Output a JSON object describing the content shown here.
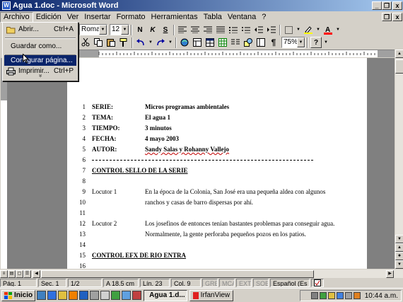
{
  "window": {
    "title": "Agua 1.doc - Microsoft Word",
    "minimize": "_",
    "restore": "❐",
    "close": "x"
  },
  "menubar": [
    "Archivo",
    "Edición",
    "Ver",
    "Insertar",
    "Formato",
    "Herramientas",
    "Tabla",
    "Ventana",
    "?"
  ],
  "doc_controls": {
    "restore": "❐",
    "close": "x"
  },
  "toolbar": {
    "font": "Roman",
    "size": "12",
    "zoom": "75%",
    "bold": "N",
    "italic": "K",
    "underline": "S",
    "help": "?"
  },
  "file_menu": {
    "items": [
      {
        "label": "Abrir...",
        "shortcut": "Ctrl+A",
        "icon": "folder-open-icon"
      },
      {
        "label": "Guardar como...",
        "shortcut": ""
      },
      {
        "label": "Configurar página...",
        "shortcut": "",
        "highlighted": true
      },
      {
        "label": "Imprimir...",
        "shortcut": "Ctrl+P",
        "icon": "printer-icon"
      }
    ],
    "expand": "»"
  },
  "document": {
    "lines": [
      {
        "n": "1",
        "c1": "SERIE:",
        "c2": "Micros programas ambientales",
        "bold": true
      },
      {
        "n": "2",
        "c1": "TEMA:",
        "c2": "El agua 1",
        "bold": true
      },
      {
        "n": "3",
        "c1": "TIEMPO:",
        "c2": "3 minutos",
        "bold": true
      },
      {
        "n": "4",
        "c1": "FECHA:",
        "c2": "4 mayo 2003",
        "bold": true
      },
      {
        "n": "5",
        "c1": "AUTOR:",
        "c2": "Sandy Salas y Rohanny Vallejo",
        "bold": true
      },
      {
        "n": "6"
      },
      {
        "n": "7",
        "c1": "CONTROL   SELLO DE LA SERIE"
      },
      {
        "n": "8"
      },
      {
        "n": "9",
        "c1": "Locutor 1",
        "c2": "En la época de la Colonia, San José era una pequeña aldea con algunos"
      },
      {
        "n": "10",
        "c2": "ranchos y casas de barro dispersas por ahí."
      },
      {
        "n": "11"
      },
      {
        "n": "12",
        "c1": "Locutor 2",
        "c2": "Los josefinos de entonces tenían bastantes problemas para conseguir agua."
      },
      {
        "n": "13",
        "c2": "Normalmente, la gente perforaba pequeños pozos en los patios."
      },
      {
        "n": "14"
      },
      {
        "n": "15",
        "c1": "CONTROL   EFX DE RIO ENTRA"
      },
      {
        "n": "16"
      }
    ]
  },
  "statusbar": {
    "page": "Pág. 1",
    "section": "Sec. 1",
    "pages": "1/2",
    "position": "A 18.5 cm",
    "line": "Lín. 23",
    "col": "Col. 9",
    "grb": "GRB",
    "mca": "MCA",
    "ext": "EXT",
    "sob": "SOB",
    "lang": "Español (Es"
  },
  "taskbar": {
    "start": "Inicio",
    "tasks": [
      "Agua 1.d...",
      "IrfanView"
    ],
    "clock": "10:44 a.m."
  },
  "colors": {
    "title_start": "#0a246a",
    "title_end": "#a6caf0",
    "highlight": "#0a246a",
    "face": "#d4d0c8"
  }
}
